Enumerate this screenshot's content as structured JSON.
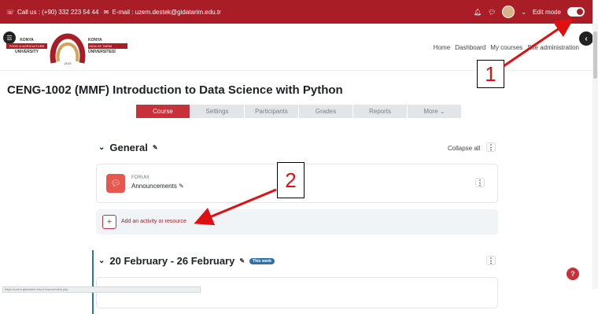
{
  "topbar": {
    "phone": "Call us : (+90) 332 223 54 44",
    "email": "E-mail : uzem.destek@gidatarim.edu.tr",
    "edit_mode_label": "Edit mode"
  },
  "logo": {
    "left_line1": "KONYA",
    "left_tag": "FOOD & AGRICULTURE",
    "left_line2": "UNIVERSITY",
    "year": "2013",
    "right_line1": "KONYA",
    "right_tag": "GIDA VE TARIM",
    "right_line2": "ÜNİVERSİTESİ"
  },
  "nav": [
    "Home",
    "Dashboard",
    "My courses",
    "Site administration"
  ],
  "course": {
    "title": "CENG-1002 (MMF) Introduction to Data Science with Python"
  },
  "tabs": [
    "Course",
    "Settings",
    "Participants",
    "Grades",
    "Reports",
    "More ⌄"
  ],
  "general": {
    "title": "General",
    "collapse_all": "Collapse all",
    "activity_type": "FORUM",
    "activity_name": "Announcements",
    "add_label": "Add an activity or resource"
  },
  "week": {
    "title": "20 February - 26 February",
    "badge": "This week"
  },
  "statusbar": "https://uzem.gidatarim.edu.tr/course/view.php",
  "annotations": [
    "1",
    "2"
  ],
  "colors": {
    "brand": "#a81d26",
    "active_tab": "#c8313a",
    "accent_blue": "#2b72b0",
    "arrow": "#e01010"
  }
}
